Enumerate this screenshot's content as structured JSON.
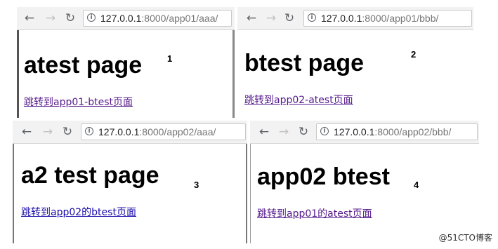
{
  "panels": [
    {
      "url_host": "127.0.0.1",
      "url_path": ":8000/app01/aaa/",
      "heading": "atest page",
      "link_text": "跳转到app01-btest页面",
      "number": "1"
    },
    {
      "url_host": "127.0.0.1",
      "url_path": ":8000/app01/bbb/",
      "heading": "btest page",
      "link_text": "跳转到app02-atest页面",
      "number": "2"
    },
    {
      "url_host": "127.0.0.1",
      "url_path": ":8000/app02/aaa/",
      "heading": "a2 test page",
      "link_text": "跳转到app02的btest页面",
      "number": "3"
    },
    {
      "url_host": "127.0.0.1",
      "url_path": ":8000/app02/bbb/",
      "heading": "app02 btest",
      "link_text": "跳转到app01的atest页面",
      "number": "4"
    }
  ],
  "toolbar": {
    "back_icon": "←",
    "forward_icon": "→",
    "reload_icon": "↻",
    "info_icon": "i"
  },
  "watermark": "@51CTO博客",
  "colors": {
    "link_visited": "#551a8b",
    "link_unvisited": "#1a0dab",
    "toolbar_bg": "#f2f2f2"
  }
}
